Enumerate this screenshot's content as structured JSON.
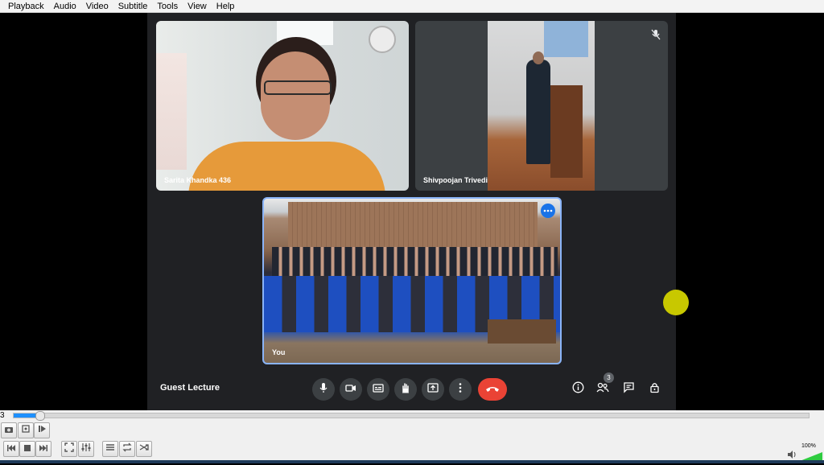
{
  "menu": {
    "items": [
      "Playback",
      "Audio",
      "Video",
      "Subtitle",
      "Tools",
      "View",
      "Help"
    ]
  },
  "meet": {
    "participants": [
      {
        "name": "Sarita Khandka 436"
      },
      {
        "name": "Shivpoojan Trivedi"
      },
      {
        "name": "You"
      }
    ],
    "meeting_title": "Guest Lecture",
    "people_count": "3",
    "icons": {
      "mic": "mic-icon",
      "camera": "camera-icon",
      "captions": "captions-icon",
      "hand": "raise-hand-icon",
      "present": "present-icon",
      "more": "more-vert-icon",
      "end": "end-call-icon",
      "info": "info-icon",
      "people": "people-icon",
      "chat": "chat-icon",
      "activities": "lock-person-icon"
    },
    "colors": {
      "background": "#202124",
      "end_call": "#ea4335",
      "speaking_border": "#8ab4f8"
    }
  },
  "player": {
    "time_left": "3",
    "progress": 0.032,
    "volume": "100%",
    "seek_color": "#1e90ff"
  }
}
